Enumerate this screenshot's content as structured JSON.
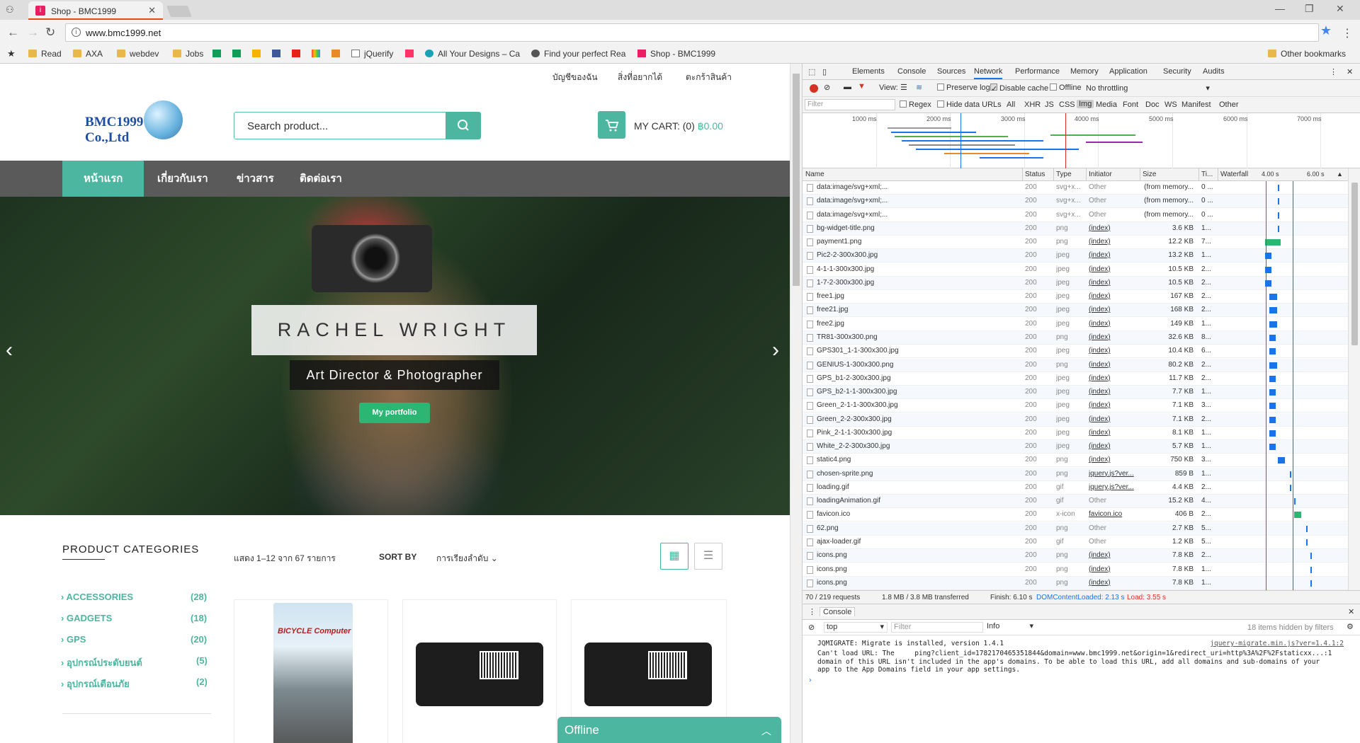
{
  "browser": {
    "tab_title": "Shop - BMC1999",
    "url": "www.bmc1999.net",
    "bookmarks": [
      {
        "label": "Read",
        "icon": "folder-icon"
      },
      {
        "label": "AXA",
        "icon": "folder-icon"
      },
      {
        "label": "webdev",
        "icon": "folder-icon"
      },
      {
        "label": "Jobs",
        "icon": "folder-icon"
      },
      {
        "label": "jQuerify",
        "icon": "page-icon"
      },
      {
        "label": "All Your Designs – Ca",
        "icon": "site-icon"
      },
      {
        "label": "Find your perfect Rea",
        "icon": "site-icon"
      },
      {
        "label": "Shop - BMC1999",
        "icon": "site-icon"
      }
    ],
    "other_bookmarks": "Other bookmarks"
  },
  "site": {
    "top_links": [
      "บัญชีของฉัน",
      "สิ่งที่อยากได้",
      "ตะกร้าสินค้า"
    ],
    "logo_text": "BMC1999 Co.,Ltd",
    "search_placeholder": "Search product...",
    "cart_label": "MY CART: (0)",
    "cart_amount": "฿0.00",
    "nav": [
      "หน้าแรก",
      "เกี่ยวกับเรา",
      "ข่าวสาร",
      "ติดต่อเรา"
    ],
    "hero": {
      "title": "RACHEL WRIGHT",
      "subtitle": "Art Director & Photographer",
      "button": "My portfolio"
    },
    "categories_title": "PRODUCT CATEGORIES",
    "categories": [
      {
        "name": "ACCESSORIES",
        "count": "(28)"
      },
      {
        "name": "GADGETS",
        "count": "(18)"
      },
      {
        "name": "GPS",
        "count": "(20)"
      },
      {
        "name": "อุปกรณ์ประดับยนต์",
        "count": "(5)"
      },
      {
        "name": "อุปกรณ์เตือนภัย",
        "count": "(2)"
      }
    ],
    "showing_text": "แสดง 1–12 จาก 67 รายการ",
    "sort_label": "SORT BY",
    "sort_value": "การเรียงลำดับ",
    "product1_label": "BICYCLE Computer",
    "offline_label": "Offline"
  },
  "devtools": {
    "tabs": [
      "Elements",
      "Console",
      "Sources",
      "Network",
      "Performance",
      "Memory",
      "Application",
      "Security",
      "Audits"
    ],
    "active_tab": "Network",
    "view_label": "View:",
    "preserve_log": "Preserve log",
    "disable_cache": "Disable cache",
    "offline": "Offline",
    "throttling": "No throttling",
    "filter_placeholder": "Filter",
    "regex": "Regex",
    "hide_data_urls": "Hide data URLs",
    "type_filters": [
      "All",
      "XHR",
      "JS",
      "CSS",
      "Img",
      "Media",
      "Font",
      "Doc",
      "WS",
      "Manifest",
      "Other"
    ],
    "active_type": "Img",
    "overview_ticks": [
      "1000 ms",
      "2000 ms",
      "3000 ms",
      "4000 ms",
      "5000 ms",
      "6000 ms",
      "7000 ms"
    ],
    "columns": [
      "Name",
      "Status",
      "Type",
      "Initiator",
      "Size",
      "Ti...",
      "Waterfall"
    ],
    "waterfall_ticks": [
      "4.00 s",
      "6.00 s"
    ],
    "rows": [
      {
        "name": "data:image/svg+xml;...",
        "status": "200",
        "type": "svg+x...",
        "initiator": "Other",
        "size": "(from memory...",
        "time": "0 ...",
        "wf_start": 0.28,
        "wf_len": 0.01
      },
      {
        "name": "data:image/svg+xml;...",
        "status": "200",
        "type": "svg+x...",
        "initiator": "Other",
        "size": "(from memory...",
        "time": "0 ...",
        "wf_start": 0.28,
        "wf_len": 0.01
      },
      {
        "name": "data:image/svg+xml;...",
        "status": "200",
        "type": "svg+x...",
        "initiator": "Other",
        "size": "(from memory...",
        "time": "0 ...",
        "wf_start": 0.28,
        "wf_len": 0.01
      },
      {
        "name": "bg-widget-title.png",
        "status": "200",
        "type": "png",
        "initiator": "(index)",
        "size": "3.6 KB",
        "time": "1...",
        "wf_start": 0.28,
        "wf_len": 0.01
      },
      {
        "name": "payment1.png",
        "status": "200",
        "type": "png",
        "initiator": "(index)",
        "size": "12.2 KB",
        "time": "7...",
        "wf_start": 0.22,
        "wf_len": 0.12
      },
      {
        "name": "Pic2-2-300x300.jpg",
        "status": "200",
        "type": "jpeg",
        "initiator": "(index)",
        "size": "13.2 KB",
        "time": "1...",
        "wf_start": 0.22,
        "wf_len": 0.05
      },
      {
        "name": "4-1-1-300x300.jpg",
        "status": "200",
        "type": "jpeg",
        "initiator": "(index)",
        "size": "10.5 KB",
        "time": "2...",
        "wf_start": 0.22,
        "wf_len": 0.05
      },
      {
        "name": "1-7-2-300x300.jpg",
        "status": "200",
        "type": "jpeg",
        "initiator": "(index)",
        "size": "10.5 KB",
        "time": "2...",
        "wf_start": 0.22,
        "wf_len": 0.05
      },
      {
        "name": "free1.jpg",
        "status": "200",
        "type": "jpeg",
        "initiator": "(index)",
        "size": "167 KB",
        "time": "2...",
        "wf_start": 0.24,
        "wf_len": 0.06
      },
      {
        "name": "free21.jpg",
        "status": "200",
        "type": "jpeg",
        "initiator": "(index)",
        "size": "168 KB",
        "time": "2...",
        "wf_start": 0.24,
        "wf_len": 0.06
      },
      {
        "name": "free2.jpg",
        "status": "200",
        "type": "jpeg",
        "initiator": "(index)",
        "size": "149 KB",
        "time": "1...",
        "wf_start": 0.24,
        "wf_len": 0.06
      },
      {
        "name": "TR81-300x300.png",
        "status": "200",
        "type": "png",
        "initiator": "(index)",
        "size": "32.6 KB",
        "time": "8...",
        "wf_start": 0.24,
        "wf_len": 0.05
      },
      {
        "name": "GPS301_1-1-300x300.jpg",
        "status": "200",
        "type": "jpeg",
        "initiator": "(index)",
        "size": "10.4 KB",
        "time": "6...",
        "wf_start": 0.24,
        "wf_len": 0.05
      },
      {
        "name": "GENIUS-1-300x300.png",
        "status": "200",
        "type": "png",
        "initiator": "(index)",
        "size": "80.2 KB",
        "time": "2...",
        "wf_start": 0.24,
        "wf_len": 0.06
      },
      {
        "name": "GPS_b1-2-300x300.jpg",
        "status": "200",
        "type": "jpeg",
        "initiator": "(index)",
        "size": "11.7 KB",
        "time": "2...",
        "wf_start": 0.24,
        "wf_len": 0.05
      },
      {
        "name": "GPS_b2-1-1-300x300.jpg",
        "status": "200",
        "type": "jpeg",
        "initiator": "(index)",
        "size": "7.7 KB",
        "time": "1...",
        "wf_start": 0.24,
        "wf_len": 0.05
      },
      {
        "name": "Green_2-1-1-300x300.jpg",
        "status": "200",
        "type": "jpeg",
        "initiator": "(index)",
        "size": "7.1 KB",
        "time": "3...",
        "wf_start": 0.24,
        "wf_len": 0.05
      },
      {
        "name": "Green_2-2-300x300.jpg",
        "status": "200",
        "type": "jpeg",
        "initiator": "(index)",
        "size": "7.1 KB",
        "time": "2...",
        "wf_start": 0.24,
        "wf_len": 0.05
      },
      {
        "name": "Pink_2-1-1-300x300.jpg",
        "status": "200",
        "type": "jpeg",
        "initiator": "(index)",
        "size": "8.1 KB",
        "time": "1...",
        "wf_start": 0.24,
        "wf_len": 0.05
      },
      {
        "name": "White_2-2-300x300.jpg",
        "status": "200",
        "type": "jpeg",
        "initiator": "(index)",
        "size": "5.7 KB",
        "time": "1...",
        "wf_start": 0.24,
        "wf_len": 0.05
      },
      {
        "name": "static4.png",
        "status": "200",
        "type": "png",
        "initiator": "(index)",
        "size": "750 KB",
        "time": "3...",
        "wf_start": 0.28,
        "wf_len": 0.06
      },
      {
        "name": "chosen-sprite.png",
        "status": "200",
        "type": "png",
        "initiator": "jquery.js?ver...",
        "size": "859 B",
        "time": "1...",
        "wf_start": 0.34,
        "wf_len": 0.01
      },
      {
        "name": "loading.gif",
        "status": "200",
        "type": "gif",
        "initiator": "jquery.js?ver...",
        "size": "4.4 KB",
        "time": "2...",
        "wf_start": 0.34,
        "wf_len": 0.01
      },
      {
        "name": "loadingAnimation.gif",
        "status": "200",
        "type": "gif",
        "initiator": "Other",
        "size": "15.2 KB",
        "time": "4...",
        "wf_start": 0.36,
        "wf_len": 0.01
      },
      {
        "name": "favicon.ico",
        "status": "200",
        "type": "x-icon",
        "initiator": "favicon.ico",
        "size": "406 B",
        "time": "2...",
        "wf_start": 0.36,
        "wf_len": 0.06
      },
      {
        "name": "62.png",
        "status": "200",
        "type": "png",
        "initiator": "Other",
        "size": "2.7 KB",
        "time": "5...",
        "wf_start": 0.42,
        "wf_len": 0.01
      },
      {
        "name": "ajax-loader.gif",
        "status": "200",
        "type": "gif",
        "initiator": "Other",
        "size": "1.2 KB",
        "time": "5...",
        "wf_start": 0.42,
        "wf_len": 0.01
      },
      {
        "name": "icons.png",
        "status": "200",
        "type": "png",
        "initiator": "(index)",
        "size": "7.8 KB",
        "time": "2...",
        "wf_start": 0.44,
        "wf_len": 0.01
      },
      {
        "name": "icons.png",
        "status": "200",
        "type": "png",
        "initiator": "(index)",
        "size": "7.8 KB",
        "time": "1...",
        "wf_start": 0.44,
        "wf_len": 0.01
      },
      {
        "name": "icons.png",
        "status": "200",
        "type": "png",
        "initiator": "(index)",
        "size": "7.8 KB",
        "time": "1...",
        "wf_start": 0.44,
        "wf_len": 0.01
      }
    ],
    "summary": {
      "requests": "70 / 219 requests",
      "transferred": "1.8 MB / 3.8 MB transferred",
      "finish": "Finish: 6.10 s",
      "dcl": "DOMContentLoaded: 2.13 s",
      "load": "Load: 3.55 s"
    },
    "console": {
      "tab": "Console",
      "context": "top",
      "filter_placeholder": "Filter",
      "level": "Info",
      "hidden": "18 items hidden by filters",
      "messages": [
        {
          "text": "JQMIGRATE: Migrate is installed, version 1.4.1",
          "source": "jquery-migrate.min.js?ver=1.4.1:2"
        },
        {
          "text": "Can't load URL: The     ping?client_id=1782170465351844&domain=www.bmc1999.net&origin=1&redirect_uri=http%3A%2F%2Fstaticxx...:1\ndomain of this URL isn't included in the app's domains. To be able to load this URL, add all domains and sub-domains of your\napp to the App Domains field in your app settings.",
          "source": ""
        }
      ]
    }
  },
  "colors": {
    "accent": "#4db6a0",
    "nav_bg": "#5a5a5a",
    "waterfall": "#1a73e8",
    "dcl_line": "#1a73e8",
    "load_line": "#d93025"
  }
}
